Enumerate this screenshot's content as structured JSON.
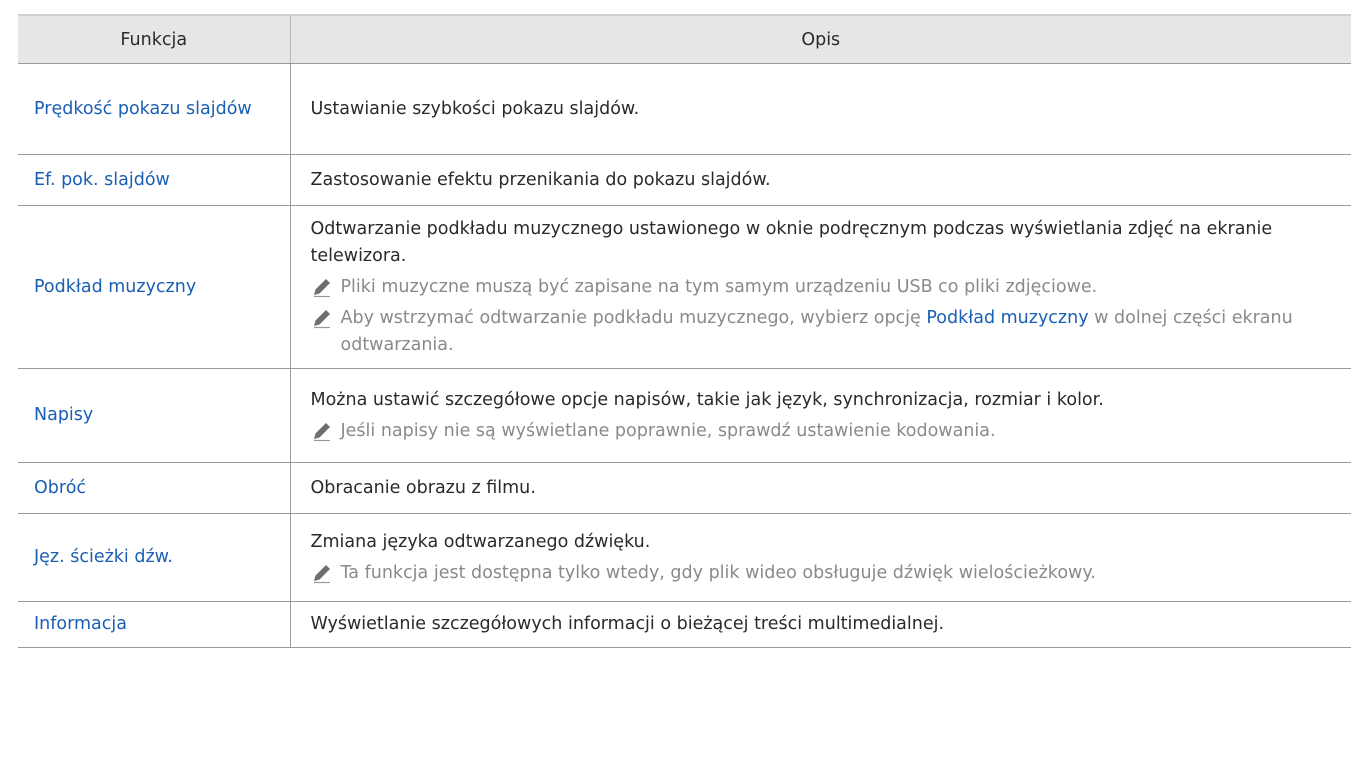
{
  "header": {
    "col_function": "Funkcja",
    "col_description": "Opis"
  },
  "colors": {
    "link": "#1a5fb4",
    "note_text": "#8a8a8a",
    "header_bg": "#e6e6e6"
  },
  "rows": [
    {
      "name": "Prędkość pokazu slajdów",
      "desc": "Ustawianie szybkości pokazu slajdów."
    },
    {
      "name": "Ef. pok. slajdów",
      "desc": "Zastosowanie efektu przenikania do pokazu slajdów."
    },
    {
      "name": "Podkład muzyczny",
      "desc": "Odtwarzanie podkładu muzycznego ustawionego w oknie podręcznym podczas wyświetlania zdjęć na ekranie telewizora.",
      "notes": [
        "Pliki muzyczne muszą być zapisane na tym samym urządzeniu USB co pliki zdjęciowe.",
        {
          "before": "Aby wstrzymać odtwarzanie podkładu muzycznego, wybierz opcję ",
          "link": "Podkład muzyczny",
          "after": " w dolnej części ekranu odtwarzania."
        }
      ]
    },
    {
      "name": "Napisy",
      "desc": "Można ustawić szczegółowe opcje napisów, takie jak język, synchronizacja, rozmiar i kolor.",
      "notes": [
        "Jeśli napisy nie są wyświetlane poprawnie, sprawdź ustawienie kodowania."
      ]
    },
    {
      "name": "Obróć",
      "desc": "Obracanie obrazu z filmu."
    },
    {
      "name": "Jęz. ścieżki dźw.",
      "desc": "Zmiana języka odtwarzanego dźwięku.",
      "notes": [
        "Ta funkcja jest dostępna tylko wtedy, gdy plik wideo obsługuje dźwięk wielościeżkowy."
      ]
    },
    {
      "name": "Informacja",
      "desc": "Wyświetlanie szczegółowych informacji o bieżącej treści multimedialnej."
    }
  ],
  "note_icon": "pencil-icon"
}
